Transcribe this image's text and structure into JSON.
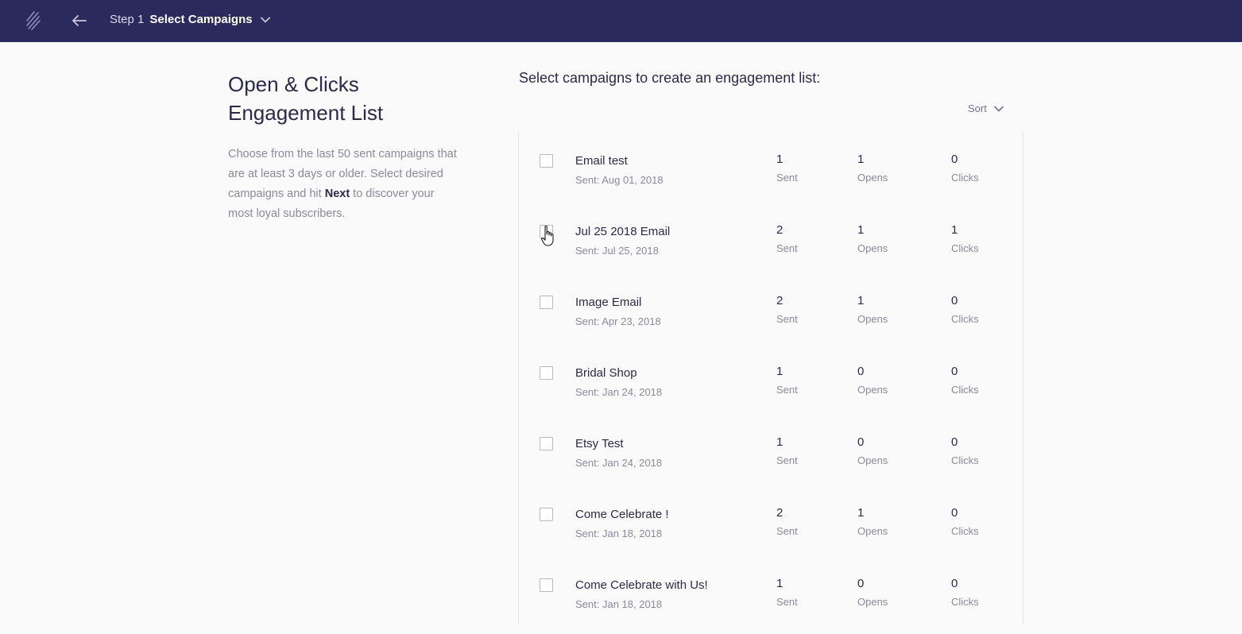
{
  "header": {
    "step_number": "Step 1",
    "step_title": "Select Campaigns"
  },
  "sidebar": {
    "title": "Open & Clicks Engagement List",
    "description_part1": "Choose from the last 50 sent campaigns that are at least 3 days or older. Select desired campaigns and hit ",
    "description_bold": "Next",
    "description_part2": " to discover your most loyal subscribers."
  },
  "main": {
    "heading": "Select campaigns to create an engagement list:",
    "sort_label": "Sort",
    "stat_labels": {
      "sent": "Sent",
      "opens": "Opens",
      "clicks": "Clicks"
    },
    "campaigns": [
      {
        "name": "Email test",
        "date": "Sent: Aug 01, 2018",
        "sent": "1",
        "opens": "1",
        "clicks": "0"
      },
      {
        "name": "Jul 25 2018 Email",
        "date": "Sent: Jul 25, 2018",
        "sent": "2",
        "opens": "1",
        "clicks": "1"
      },
      {
        "name": "Image Email",
        "date": "Sent: Apr 23, 2018",
        "sent": "2",
        "opens": "1",
        "clicks": "0"
      },
      {
        "name": "Bridal Shop",
        "date": "Sent: Jan 24, 2018",
        "sent": "1",
        "opens": "0",
        "clicks": "0"
      },
      {
        "name": "Etsy Test",
        "date": "Sent: Jan 24, 2018",
        "sent": "1",
        "opens": "0",
        "clicks": "0"
      },
      {
        "name": "Come Celebrate !",
        "date": "Sent: Jan 18, 2018",
        "sent": "2",
        "opens": "1",
        "clicks": "0"
      },
      {
        "name": "Come Celebrate with Us!",
        "date": "Sent: Jan 18, 2018",
        "sent": "1",
        "opens": "0",
        "clicks": "0"
      }
    ]
  },
  "colors": {
    "header_bg": "#2b2a5c",
    "text_dark": "#2c2a4a",
    "text_muted": "#8b8a9e"
  },
  "icons": {
    "logo": "logo-icon",
    "back": "back-arrow-icon",
    "chevron": "chevron-down-icon",
    "cursor": "hand-pointer-cursor-icon"
  }
}
